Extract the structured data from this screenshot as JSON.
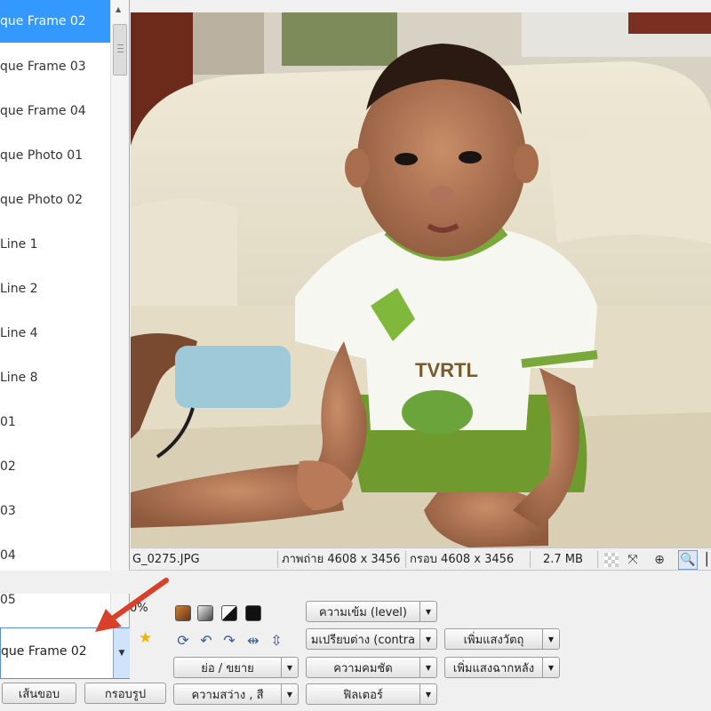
{
  "frame_list": {
    "items": [
      {
        "label": "que Frame 02",
        "selected": true
      },
      {
        "label": "que Frame 03",
        "selected": false
      },
      {
        "label": "que Frame 04",
        "selected": false
      },
      {
        "label": "que Photo 01",
        "selected": false
      },
      {
        "label": "que Photo 02",
        "selected": false
      },
      {
        "label": "Line 1",
        "selected": false
      },
      {
        "label": "Line 2",
        "selected": false
      },
      {
        "label": "Line 4",
        "selected": false
      },
      {
        "label": "Line 8",
        "selected": false
      },
      {
        "label": "01",
        "selected": false
      },
      {
        "label": "02",
        "selected": false
      },
      {
        "label": "03",
        "selected": false
      },
      {
        "label": "04",
        "selected": false
      },
      {
        "label": "05",
        "selected": false
      }
    ],
    "selected_value": "que Frame 02"
  },
  "status": {
    "filename": "G_0275.JPG",
    "photo_size": "ภาพถ่าย 4608 x 3456",
    "frame_size": "กรอบ 4608 x 3456",
    "file_size": "2.7 MB"
  },
  "panel": {
    "zoom_percent": "0%",
    "border_button": "เส้นขอบ",
    "frame_button": "กรอบรูป",
    "resize": "ย่อ / ขยาย",
    "brightness": "ความสว่าง , สี",
    "level": "ความเข้ม (level)",
    "contrast": "มเปรียบต่าง (contra",
    "sharpness": "ความคมชัด",
    "filter": "ฟิลเตอร์",
    "add_light_object": "เพิ่มแสงวัตถุ",
    "add_light_background": "เพิ่มแสงฉากหลัง"
  },
  "icons": {
    "transparency": "transparency-checker-icon",
    "fit": "fit-to-window-icon",
    "zoom_in": "zoom-in-icon",
    "zoom_actual": "zoom-actual-icon",
    "star": "star-icon",
    "rotate": "rotate-icon",
    "undo": "undo-icon",
    "redo": "redo-icon",
    "flip_h": "flip-horizontal-icon",
    "flip_v": "flip-vertical-icon",
    "scroll_down": "scroll-down-icon",
    "dropdown": "dropdown-arrow-icon"
  },
  "colors": {
    "selection": "#3399ff",
    "arrow": "#d9402a",
    "star": "#f2b200"
  }
}
